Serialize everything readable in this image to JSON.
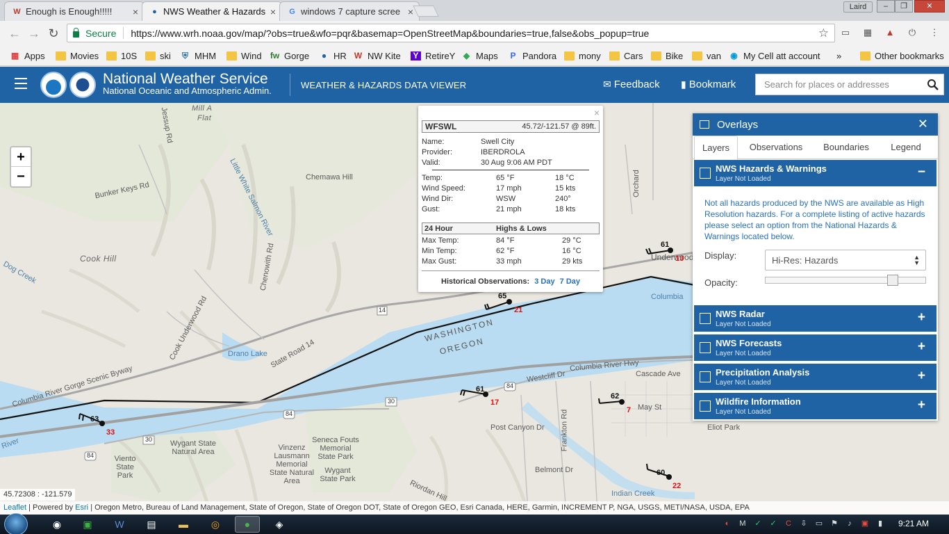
{
  "browser": {
    "tabs": [
      {
        "title": "Enough is Enough!!!!!",
        "icon": "W"
      },
      {
        "title": "NWS Weather & Hazards",
        "icon": "●"
      },
      {
        "title": "windows 7 capture scree",
        "icon": "G"
      }
    ],
    "profile_label": "Laird",
    "secure_label": "Secure",
    "url": "https://www.wrh.noaa.gov/map/?obs=true&wfo=pqr&basemap=OpenStreetMap&boundaries=true,false&obs_popup=true",
    "bookmarks": [
      {
        "label": "Apps",
        "icon": "apps-icon"
      },
      {
        "label": "Movies",
        "icon": "folder-icon"
      },
      {
        "label": "10S",
        "icon": "folder-icon"
      },
      {
        "label": "ski",
        "icon": "folder-icon"
      },
      {
        "label": "MHM",
        "icon": "mhm-icon"
      },
      {
        "label": "Wind",
        "icon": "folder-icon"
      },
      {
        "label": "Gorge",
        "icon": "gorge-icon"
      },
      {
        "label": "HR",
        "icon": "noaa-icon"
      },
      {
        "label": "NW Kite",
        "icon": "kite-icon"
      },
      {
        "label": "RetireY",
        "icon": "yahoo-icon"
      },
      {
        "label": "Maps",
        "icon": "maps-icon"
      },
      {
        "label": "Pandora",
        "icon": "pandora-icon"
      },
      {
        "label": "mony",
        "icon": "folder-icon"
      },
      {
        "label": "Cars",
        "icon": "folder-icon"
      },
      {
        "label": "Bike",
        "icon": "folder-icon"
      },
      {
        "label": "van",
        "icon": "folder-icon"
      },
      {
        "label": "My Cell att account",
        "icon": "att-icon"
      }
    ],
    "overflow_label": "»",
    "other_bookmarks": "Other bookmarks"
  },
  "header": {
    "title": "National Weather Service",
    "subtitle": "National Oceanic and Atmospheric Admin.",
    "viewer": "WEATHER & HAZARDS DATA VIEWER",
    "feedback": "Feedback",
    "bookmark": "Bookmark",
    "search_placeholder": "Search for places or addresses"
  },
  "map": {
    "zoom_in": "+",
    "zoom_out": "−",
    "labels": [
      "Mill A",
      "Flat",
      "Jessup Rd",
      "Bunker Keys Rd",
      "Little White Salmon River",
      "Chemawa Hill",
      "Cook Hill",
      "Dog Creek",
      "Chenowith Rd",
      "Cook Underwood Rd",
      "Drano Lake",
      "State Road 14",
      "Columbia River Gorge Scenic Byway",
      "WASHINGTON",
      "OREGON",
      "Westcliff Dr",
      "Columbia River Hwy",
      "Cascade Ave",
      "May St",
      "Post Canyon Dr",
      "Frankton Rd",
      "Columbia",
      "Underwood",
      "Orchard",
      "Eliot Park",
      "Seneca Fouts Memorial State Park",
      "Wygant State Natural Area",
      "Vinzenz Lausmann Memorial State Natural Area",
      "Viento State Park",
      "Wygant State Park",
      "Belmont Dr",
      "Indian Creek",
      "Riordan Hill",
      "River"
    ],
    "stations": [
      {
        "temp": "61",
        "gust": "13"
      },
      {
        "temp": "65",
        "gust": "21"
      },
      {
        "temp": "61",
        "gust": "17"
      },
      {
        "temp": "62",
        "gust": "7"
      },
      {
        "temp": "63",
        "gust": "33"
      },
      {
        "temp": "60",
        "gust": "22"
      }
    ],
    "route_shields": [
      "14",
      "84",
      "30",
      "84",
      "30",
      "84"
    ],
    "coordinates": "45.72308 : -121.579",
    "attribution": {
      "leaflet": "Leaflet",
      "powered": "| Powered by",
      "esri": "Esri",
      "sources": "| Oregon Metro, Bureau of Land Management, State of Oregon, State of Oregon DOT, State of Oregon GEO, Esri Canada, HERE, Garmin, INCREMENT P, NGA, USGS, METI/NASA, USDA, EPA"
    }
  },
  "popup": {
    "close": "×",
    "station_id": "WFSWL",
    "location": "45.72/-121.57 @ 89ft.",
    "name_label": "Name:",
    "name": "Swell City",
    "provider_label": "Provider:",
    "provider": "IBERDROLA",
    "valid_label": "Valid:",
    "valid": "30 Aug 9:06 AM PDT",
    "rows": [
      {
        "label": "Temp:",
        "v1": "65 °F",
        "v2": "18 °C"
      },
      {
        "label": "Wind Speed:",
        "v1": "17 mph",
        "v2": "15 kts"
      },
      {
        "label": "Wind Dir:",
        "v1": "WSW",
        "v2": "240°"
      },
      {
        "label": "Gust:",
        "v1": "21 mph",
        "v2": "18 kts"
      }
    ],
    "section_left": "24 Hour",
    "section_right": "Highs & Lows",
    "rows24": [
      {
        "label": "Max Temp:",
        "v1": "84 °F",
        "v2": "29 °C"
      },
      {
        "label": "Min Temp:",
        "v1": "62 °F",
        "v2": "16 °C"
      },
      {
        "label": "Max Gust:",
        "v1": "33 mph",
        "v2": "29 kts"
      }
    ],
    "historical_label": "Historical Observations:",
    "three_day": "3 Day",
    "seven_day": "7 Day"
  },
  "overlays": {
    "title": "Overlays",
    "close": "✕",
    "tabs": [
      "Layers",
      "Observations",
      "Boundaries",
      "Legend"
    ],
    "layers": [
      {
        "name": "NWS Hazards & Warnings",
        "status": "Layer Not Loaded",
        "toggle": "−"
      },
      {
        "name": "NWS Radar",
        "status": "Layer Not Loaded",
        "toggle": "+"
      },
      {
        "name": "NWS Forecasts",
        "status": "Layer Not Loaded",
        "toggle": "+"
      },
      {
        "name": "Precipitation Analysis",
        "status": "Layer Not Loaded",
        "toggle": "+"
      },
      {
        "name": "Wildfire Information",
        "status": "Layer Not Loaded",
        "toggle": "+"
      }
    ],
    "info": "Not all hazards produced by the NWS are available as High Resolution hazards. For a complete listing of active hazards please select an option from the National Hazards & Warnings located below.",
    "display_label": "Display:",
    "display_value": "Hi-Res: Hazards",
    "opacity_label": "Opacity:",
    "opacity_value": 0.82
  },
  "taskbar": {
    "clock": "9:21 AM"
  }
}
